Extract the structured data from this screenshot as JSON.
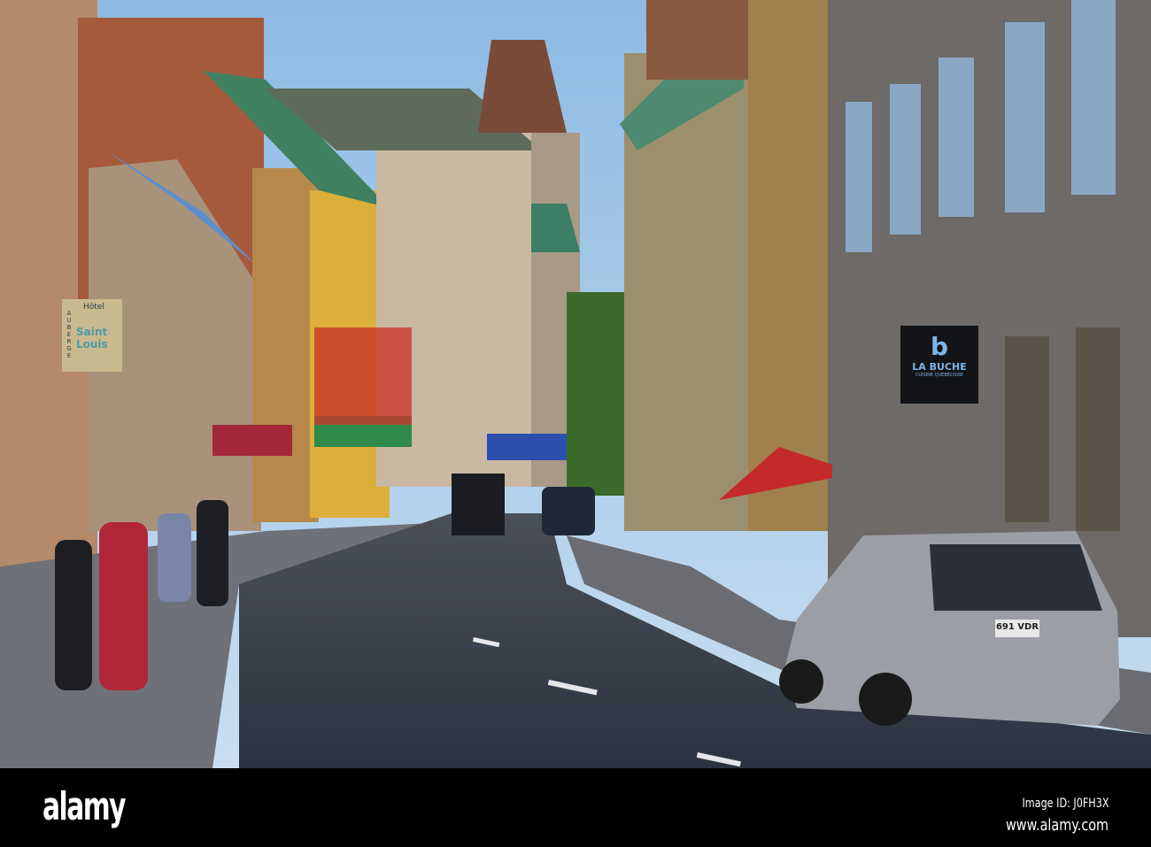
{
  "watermark": {
    "logo": "alamy",
    "image_id": "Image ID: J0FH3X",
    "url": "www.alamy.com"
  },
  "signs": {
    "la_buche": {
      "name": "LA BUCHE",
      "subtitle": "CUISINE QUÉBÉCOISE"
    },
    "auberge": {
      "top": "Hôtel",
      "side": "AUBERGE",
      "name": "Saint Louis"
    }
  },
  "car": {
    "plate": "691 VDR"
  },
  "colors": {
    "sky": "#a9cdea",
    "road": "#3b414c",
    "sidewalk": "#6d6f76",
    "footer": "#000000"
  }
}
